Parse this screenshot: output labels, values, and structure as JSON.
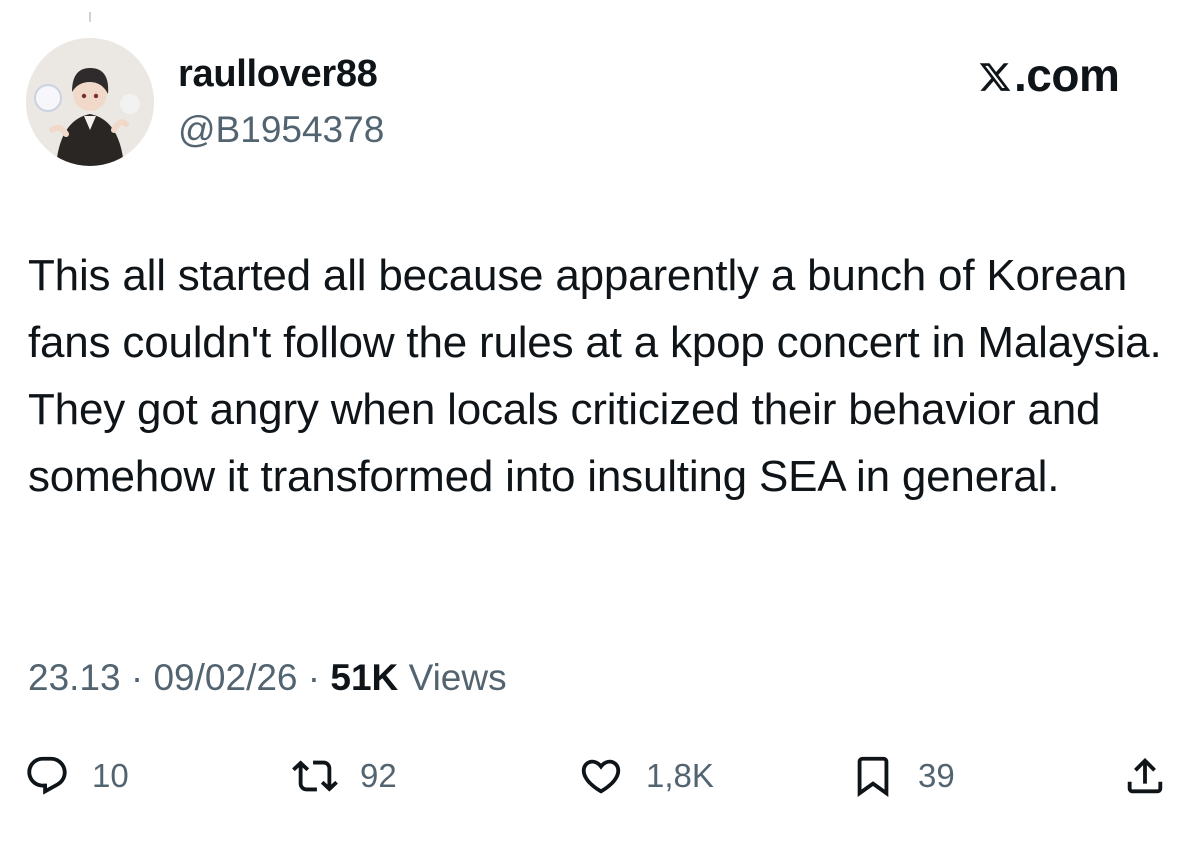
{
  "author": {
    "display_name": "raullover88",
    "handle": "@B1954378"
  },
  "brand": {
    "site_label": ".com",
    "logo_icon": "x-logo-icon"
  },
  "tweet": {
    "text": "This all started all because apparently a bunch of Korean fans couldn't follow the rules at a kpop concert in Malaysia. They got angry when locals criticized their behavior and somehow it transformed into insulting SEA in general.",
    "time": "23.13",
    "date": "09/02/26",
    "separator": " · ",
    "views_count": "51K",
    "views_label": "Views"
  },
  "actions": {
    "replies": "10",
    "retweets": "92",
    "likes": "1,8K",
    "bookmarks": "39"
  },
  "icons": {
    "reply": "reply-icon",
    "retweet": "retweet-icon",
    "like": "heart-icon",
    "bookmark": "bookmark-icon",
    "share": "share-icon"
  },
  "colors": {
    "text": "#0f1419",
    "secondary": "#536471",
    "background": "#ffffff"
  }
}
